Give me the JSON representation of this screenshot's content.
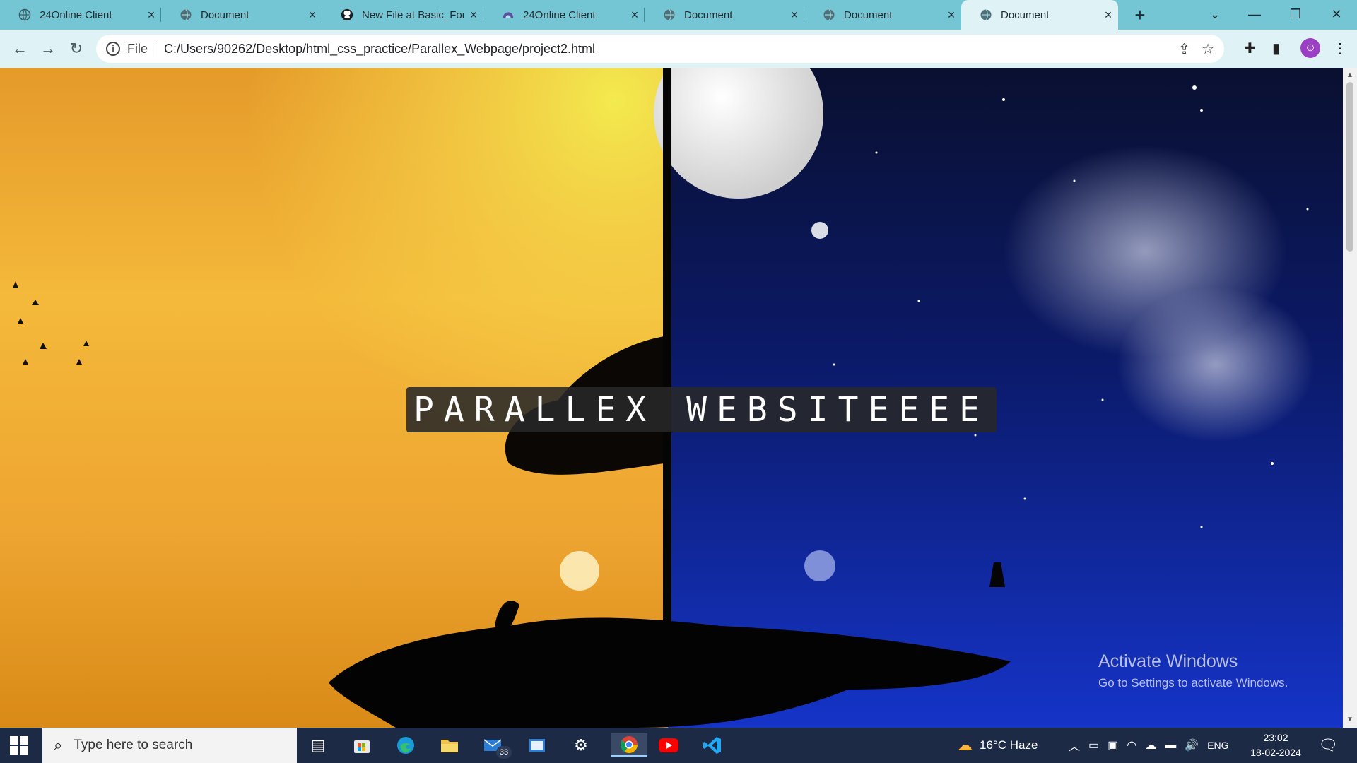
{
  "browser": {
    "tabs": [
      {
        "title": "24Online Client",
        "icon": "globe-icon"
      },
      {
        "title": "Document",
        "icon": "globe-icon"
      },
      {
        "title": "New File at Basic_For",
        "icon": "github-icon"
      },
      {
        "title": "24Online Client",
        "icon": "cloud-icon"
      },
      {
        "title": "Document",
        "icon": "globe-icon"
      },
      {
        "title": "Document",
        "icon": "globe-icon"
      },
      {
        "title": "Document",
        "icon": "globe-icon",
        "active": true
      }
    ],
    "address": {
      "scheme_label": "File",
      "url": "C:/Users/90262/Desktop/html_css_practice/Parallex_Webpage/project2.html"
    }
  },
  "page": {
    "hero_title": "PARALLEX WEBSITEEEE"
  },
  "watermark": {
    "line1": "Activate Windows",
    "line2": "Go to Settings to activate Windows."
  },
  "taskbar": {
    "search_placeholder": "Type here to search",
    "mail_badge": "33",
    "weather": "16°C  Haze",
    "language": "ENG",
    "time": "23:02",
    "date": "18-02-2024"
  },
  "colors": {
    "tabstrip_bg": "#75c6d4",
    "toolbar_bg": "#dff3f6",
    "taskbar_bg": "#1d2a45"
  }
}
